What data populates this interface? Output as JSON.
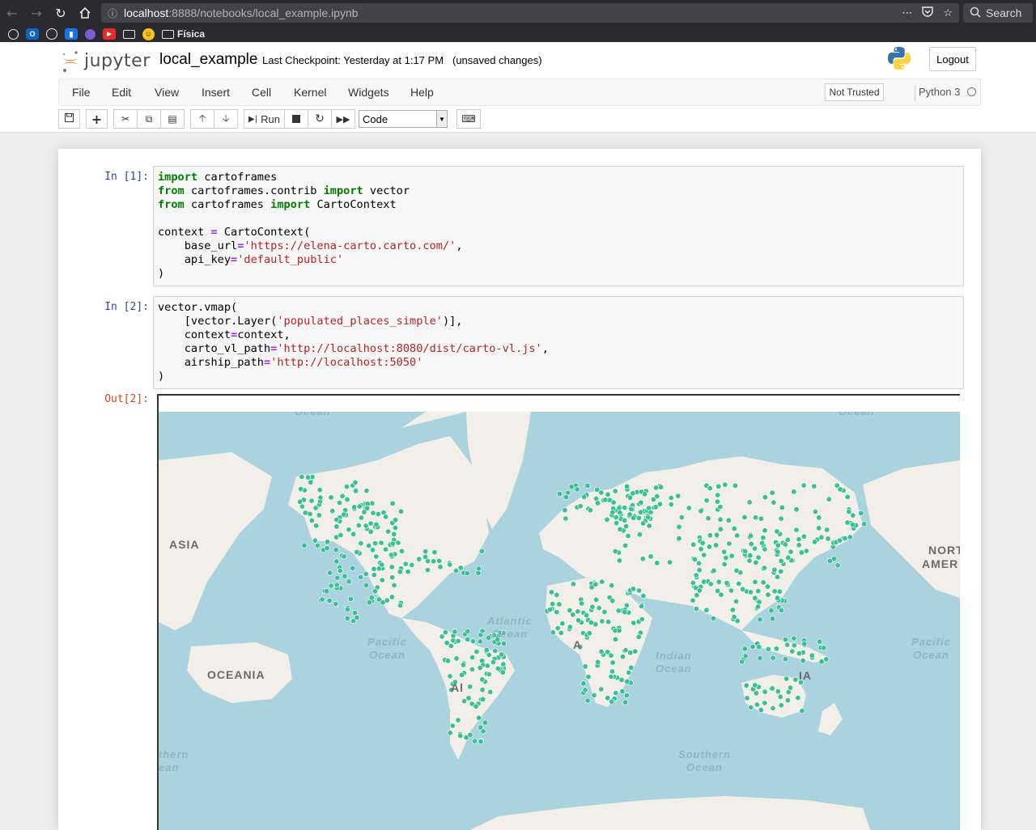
{
  "browser": {
    "url_host": "localhost",
    "url_rest": ":8888/notebooks/local_example.ipynb",
    "search_placeholder": "Search",
    "bookmark_folder": "Física"
  },
  "header": {
    "logo_text": "jupyter",
    "notebook_title": "local_example",
    "checkpoint": "Last Checkpoint: Yesterday at 1:17 PM",
    "unsaved": "(unsaved changes)",
    "logout": "Logout"
  },
  "menu": {
    "items": [
      "File",
      "Edit",
      "View",
      "Insert",
      "Cell",
      "Kernel",
      "Widgets",
      "Help"
    ],
    "trust": "Not Trusted",
    "kernel": "Python 3"
  },
  "toolbar": {
    "run_label": "Run",
    "cell_type": "Code"
  },
  "cells": [
    {
      "prompt": "In [1]:",
      "lines": [
        [
          [
            "kw",
            "import"
          ],
          [
            "t",
            " cartoframes"
          ]
        ],
        [
          [
            "kw",
            "from"
          ],
          [
            "t",
            " cartoframes.contrib "
          ],
          [
            "kw",
            "import"
          ],
          [
            "t",
            " vector"
          ]
        ],
        [
          [
            "kw",
            "from"
          ],
          [
            "t",
            " cartoframes "
          ],
          [
            "kw",
            "import"
          ],
          [
            "t",
            " CartoContext"
          ]
        ],
        [
          [
            "t",
            ""
          ]
        ],
        [
          [
            "t",
            "context "
          ],
          [
            "op",
            "="
          ],
          [
            "t",
            " CartoContext("
          ]
        ],
        [
          [
            "t",
            "    base_url"
          ],
          [
            "op",
            "="
          ],
          [
            "str",
            "'https://elena-carto.carto.com/'"
          ],
          [
            "t",
            ","
          ]
        ],
        [
          [
            "t",
            "    api_key"
          ],
          [
            "op",
            "="
          ],
          [
            "str",
            "'default_public'"
          ]
        ],
        [
          [
            "t",
            ")"
          ]
        ]
      ]
    },
    {
      "prompt": "In [2]:",
      "lines": [
        [
          [
            "t",
            "vector.vmap("
          ]
        ],
        [
          [
            "t",
            "    [vector.Layer("
          ],
          [
            "str",
            "'populated_places_simple'"
          ],
          [
            "t",
            ")],"
          ]
        ],
        [
          [
            "t",
            "    context"
          ],
          [
            "op",
            "="
          ],
          [
            "t",
            "context,"
          ]
        ],
        [
          [
            "t",
            "    carto_vl_path"
          ],
          [
            "op",
            "="
          ],
          [
            "str",
            "'http://localhost:8080/dist/carto-vl.js'"
          ],
          [
            "t",
            ","
          ]
        ],
        [
          [
            "t",
            "    airship_path"
          ],
          [
            "op",
            "="
          ],
          [
            "str",
            "'http://localhost:5050'"
          ]
        ],
        [
          [
            "t",
            ")"
          ]
        ]
      ]
    }
  ],
  "output_prompt": "Out[2]:",
  "map": {
    "continent_labels": {
      "asia": "ASIA",
      "oceania": "OCEANIA",
      "north_america_1": "NORT",
      "north_america_2": "AMER",
      "south_america": "Al",
      "africa": "A",
      "australia": "IA"
    },
    "ocean_labels": {
      "arctic_left": "Ocean",
      "arctic_right": "Ocean",
      "pacific_left": "Pacific\nOcean",
      "atlantic": "Atlantic\nOcean",
      "indian": "Indian\nOcean",
      "pacific_right": "Pacific\nOcean",
      "southern": "Southern\nOcean",
      "southern_left": "thern\nean"
    },
    "colors": {
      "water": "#aad3df",
      "land": "#f2efe9",
      "points": "#3bbf94"
    }
  }
}
